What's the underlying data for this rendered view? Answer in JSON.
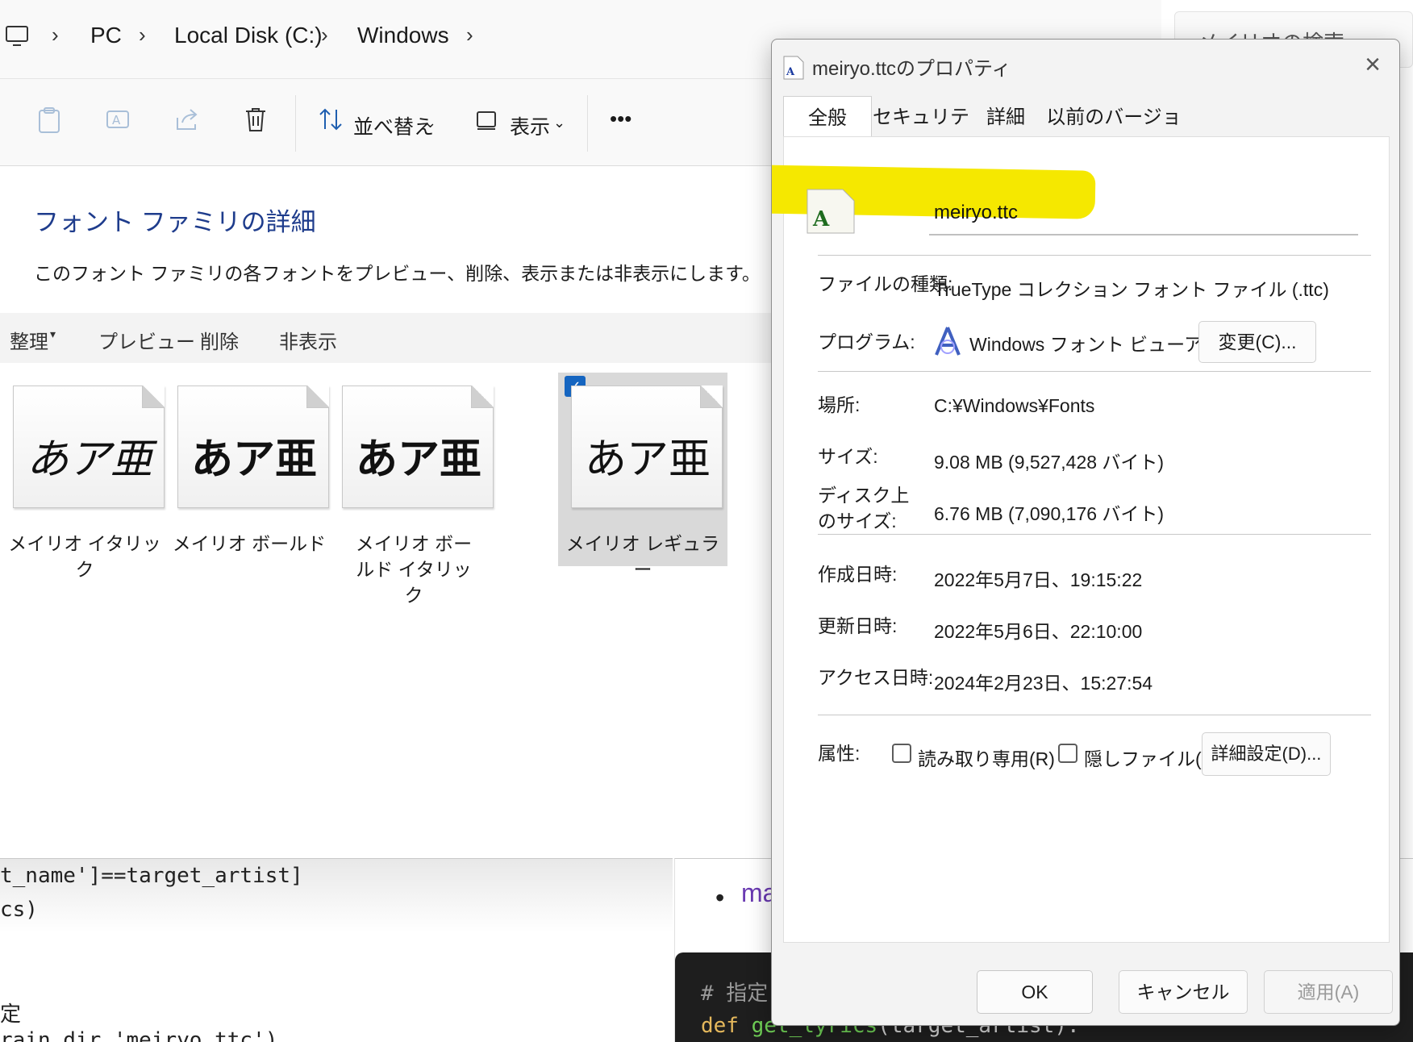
{
  "explorer": {
    "breadcrumb": [
      "PC",
      "Local Disk (C:)",
      "Windows"
    ],
    "search_placeholder": "メイリオの検索",
    "toolbar": {
      "sort_label": "並べ替え",
      "view_label": "表示",
      "more_label": "•••"
    },
    "family_title": "フォント ファミリの詳細",
    "family_desc": "このフォント ファミリの各フォントをプレビュー、削除、表示または非表示にします。",
    "commands": [
      "整理",
      "プレビュー",
      "削除",
      "非表示"
    ],
    "fonts": [
      {
        "sample": "あア亜",
        "name": "メイリオ イタリック"
      },
      {
        "sample": "あア亜",
        "name": "メイリオ ボールド"
      },
      {
        "sample": "あア亜",
        "name": "メイリオ ボールド イタリック"
      },
      {
        "sample": "あア亜",
        "name": "メイリオ レギュラー",
        "selected": true
      }
    ]
  },
  "code": {
    "left_lines": [
      "t_name']==target_artist]",
      "cs)",
      "定",
      "rain_dir,'meiryo.ttc')"
    ],
    "bullet_text": "ma",
    "comment": "# 指定",
    "def_keyword": "def",
    "def_name": "get_lyrics",
    "def_rest": "(target_artist):"
  },
  "dialog": {
    "title": "meiryo.ttcのプロパティ",
    "close": "×",
    "tabs": [
      "全般",
      "セキュリティ",
      "詳細",
      "以前のバージョン"
    ],
    "file_name": "meiryo.ttc",
    "rows": {
      "type_label": "ファイルの種類:",
      "type_value": "TrueType コレクション フォント ファイル (.ttc)",
      "program_label": "プログラム:",
      "program_value": "Windows フォント ビューアー",
      "change_button": "変更(C)...",
      "location_label": "場所:",
      "location_value": "C:¥Windows¥Fonts",
      "size_label": "サイズ:",
      "size_value": "9.08 MB (9,527,428 バイト)",
      "disk_label_1": "ディスク上",
      "disk_label_2": "のサイズ:",
      "disk_value": "6.76 MB (7,090,176 バイト)",
      "created_label": "作成日時:",
      "created_value": "2022年5月7日、19:15:22",
      "modified_label": "更新日時:",
      "modified_value": "2022年5月6日、22:10:00",
      "accessed_label": "アクセス日時:",
      "accessed_value": "2024年2月23日、15:27:54",
      "attr_label": "属性:",
      "readonly_label": "読み取り専用(R)",
      "hidden_label": "隠しファイル(H)",
      "advanced_button": "詳細設定(D)..."
    },
    "buttons": {
      "ok": "OK",
      "cancel": "キャンセル",
      "apply": "適用(A)"
    },
    "highlight_color": "#f5e800"
  }
}
